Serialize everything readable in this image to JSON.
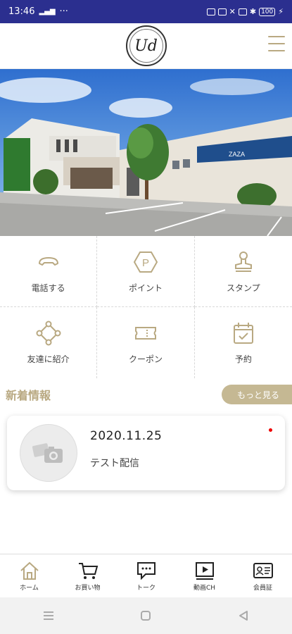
{
  "status_bar": {
    "time": "13:46",
    "battery": "100"
  },
  "header": {
    "logo_text": "Ud",
    "menu_icon": "hamburger-icon"
  },
  "hero": {
    "building_sign": "ZAZA"
  },
  "menu_grid": [
    {
      "label": "電話する",
      "icon": "phone-icon"
    },
    {
      "label": "ポイント",
      "icon": "point-icon"
    },
    {
      "label": "スタンプ",
      "icon": "stamp-icon"
    },
    {
      "label": "友達に紹介",
      "icon": "share-icon"
    },
    {
      "label": "クーポン",
      "icon": "coupon-icon"
    },
    {
      "label": "予約",
      "icon": "calendar-check-icon"
    }
  ],
  "news": {
    "section_title": "新着情報",
    "more_label": "もっと見る",
    "items": [
      {
        "date": "2020.11.25",
        "title": "テスト配信",
        "unread": true
      }
    ]
  },
  "tab_bar": [
    {
      "label": "ホーム",
      "icon": "home-icon"
    },
    {
      "label": "お買い物",
      "icon": "cart-icon"
    },
    {
      "label": "トーク",
      "icon": "chat-icon"
    },
    {
      "label": "動画CH",
      "icon": "video-icon"
    },
    {
      "label": "会員証",
      "icon": "member-card-icon"
    }
  ],
  "colors": {
    "accent": "#b9a982",
    "status_bar": "#2b2f8f",
    "unread": "#e00000"
  }
}
